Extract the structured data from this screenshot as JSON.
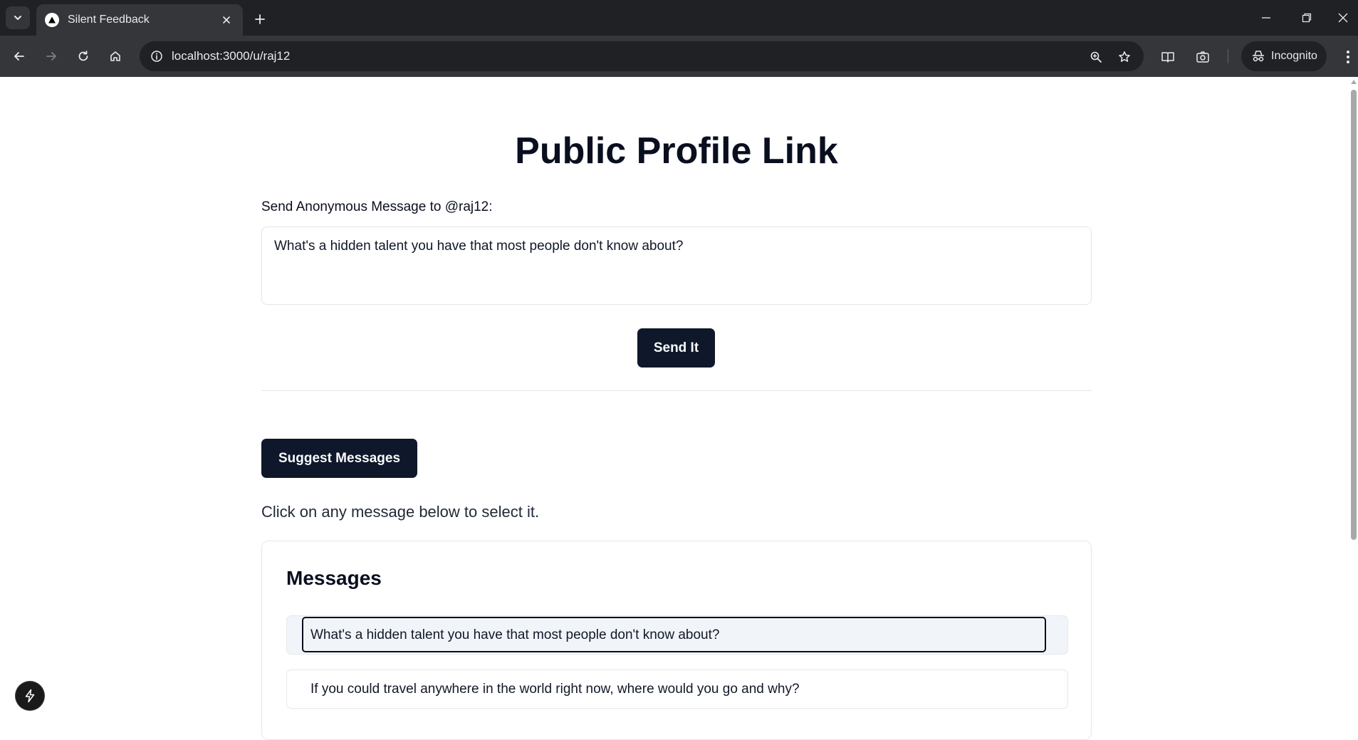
{
  "browser": {
    "tab_title": "Silent Feedback",
    "url": "localhost:3000/u/raj12",
    "incognito_label": "Incognito"
  },
  "page": {
    "title": "Public Profile Link",
    "message_label": "Send Anonymous Message to @raj12:",
    "message_value": "What's a hidden talent you have that most people don't know about?",
    "send_label": "Send It",
    "suggest_label": "Suggest Messages",
    "hint": "Click on any message below to select it.",
    "messages_card": {
      "title": "Messages",
      "items": [
        {
          "text": "What's a hidden talent you have that most people don't know about?",
          "selected": true
        },
        {
          "text": "If you could travel anywhere in the world right now, where would you go and why?",
          "selected": false
        }
      ]
    }
  },
  "colors": {
    "primary_button": "#0f172a",
    "chrome_dark": "#202124",
    "chrome_mid": "#35363a"
  },
  "icons": {
    "tab_search": "chevron-down-icon",
    "favicon": "triangle-icon",
    "tab_close": "close-icon",
    "new_tab": "plus-icon",
    "back": "arrow-left-icon",
    "forward": "arrow-right-icon",
    "reload": "reload-icon",
    "home": "home-icon",
    "site_info": "info-icon",
    "zoom": "zoom-icon",
    "bookmark": "star-icon",
    "reading_mode": "book-icon",
    "screenshot": "camera-icon",
    "incognito": "incognito-icon",
    "menu": "kebab-icon",
    "dev_badge": "lightning-icon"
  }
}
